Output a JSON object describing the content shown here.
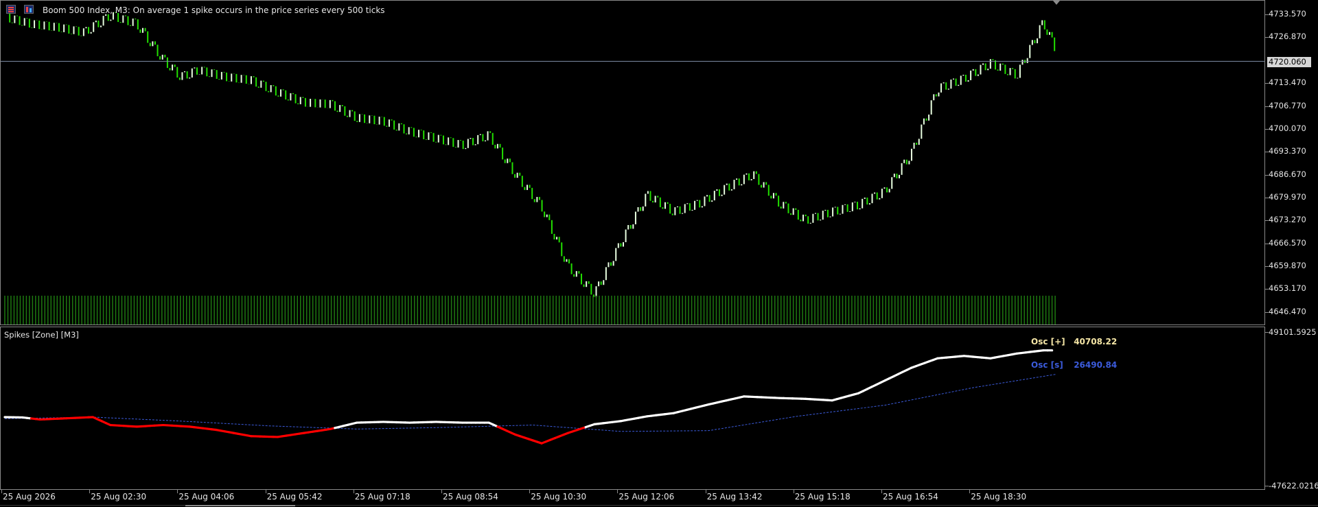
{
  "chart_header": {
    "title": "Boom 500 Index, M3:  On average 1 spike occurs in the price series every 500 ticks",
    "current_price": "4720.060"
  },
  "price_axis": {
    "labels": [
      "4733.570",
      "4726.870",
      "4713.470",
      "4706.770",
      "4700.070",
      "4693.370",
      "4686.670",
      "4679.970",
      "4673.270",
      "4666.570",
      "4659.870",
      "4653.170",
      "4646.470"
    ]
  },
  "indicator": {
    "title": "Spikes [Zone] [M3]",
    "axis_top": "49101.5925",
    "axis_bottom": "-47622.0216",
    "legend": [
      {
        "name": "Osc [+]",
        "value": "40708.22",
        "color": "#ffffff",
        "value_color": "#f5e6a6"
      },
      {
        "name": "Osc [s]",
        "value": "26490.84",
        "color": "#3b5bdb",
        "value_color": "#3b5bdb"
      }
    ]
  },
  "time_axis": {
    "labels": [
      "25 Aug 2026",
      "25 Aug 02:30",
      "25 Aug 04:06",
      "25 Aug 05:42",
      "25 Aug 07:18",
      "25 Aug 08:54",
      "25 Aug 10:30",
      "25 Aug 12:06",
      "25 Aug 13:42",
      "25 Aug 15:18",
      "25 Aug 16:54",
      "25 Aug 18:30"
    ]
  },
  "chart_data": [
    {
      "type": "line",
      "title": "Boom 500 Index, M3",
      "ylim": [
        4643.0,
        4737.0
      ],
      "x_labels": [
        "25 Aug 2026",
        "25 Aug 02:30",
        "25 Aug 04:06",
        "25 Aug 05:42",
        "25 Aug 07:18",
        "25 Aug 08:54",
        "25 Aug 10:30",
        "25 Aug 12:06",
        "25 Aug 13:42",
        "25 Aug 15:18",
        "25 Aug 16:54",
        "25 Aug 18:30"
      ],
      "series": [
        {
          "color": "#22e000",
          "x": [
            0,
            0.3,
            0.6,
            0.9,
            1.2,
            1.5,
            1.8,
            2.0,
            2.2,
            2.5,
            2.8,
            3.1,
            3.4,
            3.7,
            4.0,
            4.3,
            4.6,
            4.9,
            5.2,
            5.5,
            5.8,
            6.1,
            6.4,
            6.7,
            7.0,
            7.3,
            7.6,
            7.9,
            8.2,
            8.5,
            8.8,
            9.1,
            9.4,
            9.7,
            10.0,
            10.3,
            10.6,
            10.9,
            11.2,
            11.5,
            11.8,
            11.95
          ],
          "values": [
            4733.0,
            4731.0,
            4730.0,
            4728.5,
            4733.5,
            4731.0,
            4720.5,
            4715.5,
            4717.5,
            4715.5,
            4714.5,
            4711.0,
            4708.0,
            4707.5,
            4703.5,
            4702.5,
            4699.5,
            4697.5,
            4695.5,
            4698.5,
            4687.0,
            4677.5,
            4660.0,
            4652.0,
            4667.0,
            4681.0,
            4676.0,
            4678.5,
            4683.0,
            4687.0,
            4678.5,
            4673.5,
            4676.0,
            4678.0,
            4682.0,
            4693.0,
            4712.0,
            4715.0,
            4719.5,
            4716.0,
            4731.5,
            4723.0
          ]
        }
      ]
    },
    {
      "type": "line",
      "title": "Spikes [Zone] [M3]",
      "ylim": [
        -47622.0216,
        49101.5925
      ],
      "x_labels": [
        "25 Aug 2026",
        "25 Aug 02:30",
        "25 Aug 04:06",
        "25 Aug 05:42",
        "25 Aug 07:18",
        "25 Aug 08:54",
        "25 Aug 10:30",
        "25 Aug 12:06",
        "25 Aug 13:42",
        "25 Aug 15:18",
        "25 Aug 16:54",
        "25 Aug 18:30"
      ],
      "series": [
        {
          "name": "Osc [+]",
          "color": "#ffffff",
          "negative_color": "#ff0000",
          "x": [
            0,
            0.2,
            0.4,
            0.6,
            0.8,
            1.0,
            1.2,
            1.5,
            1.8,
            2.1,
            2.4,
            2.8,
            3.1,
            3.4,
            3.7,
            4.0,
            4.3,
            4.6,
            4.9,
            5.2,
            5.5,
            5.8,
            6.1,
            6.4,
            6.7,
            7.0,
            7.3,
            7.6,
            8.0,
            8.4,
            8.8,
            9.1,
            9.4,
            9.7,
            10.0,
            10.3,
            10.6,
            10.9,
            11.2,
            11.5,
            11.8,
            11.95
          ],
          "values": [
            -4000,
            -4200,
            -5500,
            -5000,
            -4500,
            -4000,
            -9000,
            -10000,
            -9000,
            -10000,
            -12000,
            -16000,
            -16500,
            -14000,
            -11500,
            -7500,
            -7000,
            -7500,
            -7000,
            -7500,
            -7500,
            -15000,
            -20500,
            -14000,
            -8500,
            -6500,
            -3500,
            -1500,
            4000,
            9000,
            8000,
            7500,
            6500,
            11000,
            19000,
            27000,
            33000,
            34500,
            33000,
            36000,
            38000,
            38000
          ]
        },
        {
          "name": "Osc [s]",
          "color": "#3b5bdb",
          "style": "dashed",
          "x": [
            0,
            1.0,
            2.0,
            3.0,
            4.0,
            5.0,
            6.0,
            7.0,
            8.0,
            9.0,
            10.0,
            11.0,
            11.95
          ],
          "values": [
            -5000,
            -4000,
            -6500,
            -9500,
            -11500,
            -10500,
            -9000,
            -13000,
            -12500,
            -3500,
            3500,
            14500,
            23000
          ]
        }
      ]
    }
  ]
}
